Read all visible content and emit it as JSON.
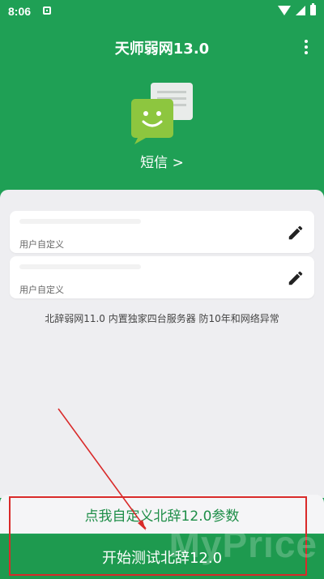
{
  "status": {
    "time": "8:06"
  },
  "header": {
    "title": "天师弱网13.0"
  },
  "sms": {
    "label": "短信 >"
  },
  "params": [
    {
      "sub_label": "用户自定义"
    },
    {
      "sub_label": "用户自定义"
    }
  ],
  "note": "北辞弱网11.0 内置独家四台服务器 防10年和网络异常",
  "buttons": {
    "custom_label": "点我自定义北辞12.0参数",
    "start_label": "开始测试北辞12.0"
  },
  "watermark": "MyPrice",
  "colors": {
    "primary_green": "#1fa055",
    "button_text_green": "#1e8e48",
    "annotation_red": "#d92a2a"
  }
}
